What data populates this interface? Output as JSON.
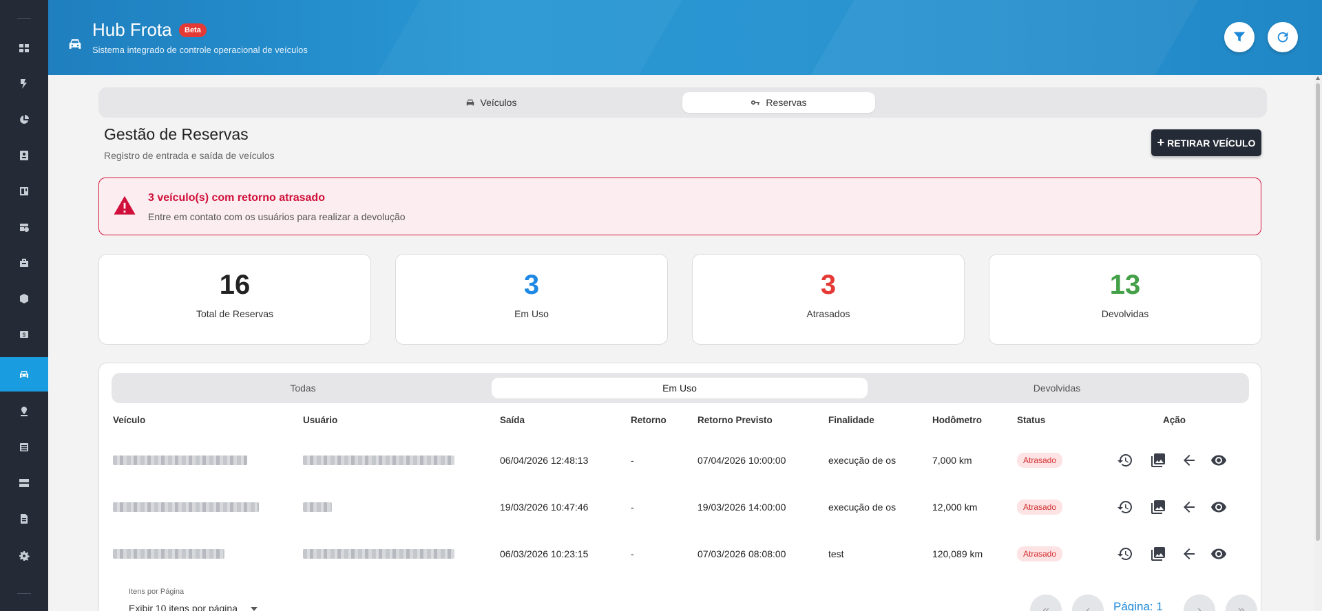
{
  "header": {
    "title": "Hub Frota",
    "badge": "Beta",
    "subtitle": "Sistema integrado de controle operacional de veículos"
  },
  "sidebar": {
    "items": [
      {
        "icon": "dashboard-icon"
      },
      {
        "icon": "flash-icon"
      },
      {
        "icon": "pie-chart-icon"
      },
      {
        "icon": "contact-card-icon"
      },
      {
        "icon": "board-icon"
      },
      {
        "icon": "calendar-clock-icon"
      },
      {
        "icon": "toolbox-icon"
      },
      {
        "icon": "package-icon"
      },
      {
        "icon": "money-icon"
      },
      {
        "icon": "car-icon",
        "active": true
      },
      {
        "icon": "location-icon"
      },
      {
        "icon": "list-icon"
      },
      {
        "icon": "server-icon"
      },
      {
        "icon": "document-icon"
      },
      {
        "icon": "gear-icon"
      }
    ]
  },
  "main_tabs": [
    {
      "label": "Veículos",
      "icon": "car-icon",
      "active": false
    },
    {
      "label": "Reservas",
      "icon": "key-icon",
      "active": true
    }
  ],
  "page": {
    "title": "Gestão de Reservas",
    "subtitle": "Registro de entrada e saída de veículos",
    "action_button": "RETIRAR VEÍCULO"
  },
  "alert": {
    "title": "3 veículo(s) com retorno atrasado",
    "text": "Entre em contato com os usuários para realizar a devolução"
  },
  "stats": [
    {
      "value": "16",
      "label": "Total de Reservas",
      "color": "#222222"
    },
    {
      "value": "3",
      "label": "Em Uso",
      "color": "#1e88e5"
    },
    {
      "value": "3",
      "label": "Atrasados",
      "color": "#e53935"
    },
    {
      "value": "13",
      "label": "Devolvidas",
      "color": "#43a047"
    }
  ],
  "sub_tabs": [
    {
      "label": "Todas",
      "active": false
    },
    {
      "label": "Em Uso",
      "active": true
    },
    {
      "label": "Devolvidas",
      "active": false
    }
  ],
  "table": {
    "columns": [
      "Veículo",
      "Usuário",
      "Saída",
      "Retorno",
      "Retorno Previsto",
      "Finalidade",
      "Hodômetro",
      "Status",
      "Ação"
    ],
    "rows": [
      {
        "saida": "06/04/2026 12:48:13",
        "retorno": "-",
        "previsto": "07/04/2026 10:00:00",
        "finalidade": "execução de os",
        "hodometro": "7,000 km",
        "status": "Atrasado"
      },
      {
        "saida": "19/03/2026 10:47:46",
        "retorno": "-",
        "previsto": "19/03/2026 14:00:00",
        "finalidade": "execução de os",
        "hodometro": "12,000 km",
        "status": "Atrasado"
      },
      {
        "saida": "06/03/2026 10:23:15",
        "retorno": "-",
        "previsto": "07/03/2026 08:08:00",
        "finalidade": "test",
        "hodometro": "120,089 km",
        "status": "Atrasado"
      }
    ]
  },
  "pagination": {
    "label": "Itens por Página",
    "select_value": "Exibir 10 itens por página",
    "page_text": "Página: 1"
  }
}
